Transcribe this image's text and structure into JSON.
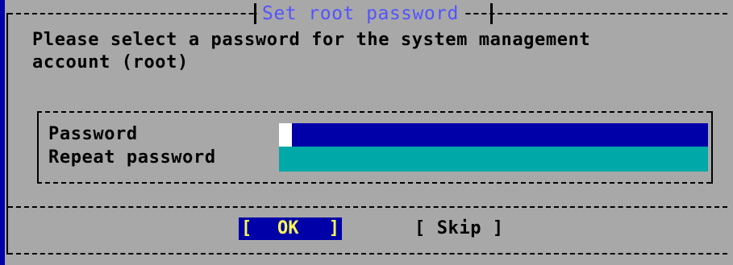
{
  "dialog": {
    "title": "Set root password",
    "prompt": "Please select a password for the system management\naccount (root)"
  },
  "form": {
    "password_label": "Password",
    "repeat_label": "Repeat password",
    "password_value": "",
    "repeat_value": ""
  },
  "buttons": {
    "ok_open": "[",
    "ok_label": "OK",
    "ok_close": "]",
    "skip_label": "[ Skip ]"
  },
  "colors": {
    "background": "#0000a8",
    "dialog": "#a8a8a8",
    "title": "#5454fc",
    "active_field": "#0000a8",
    "inactive_field": "#00a8a8",
    "selected_button_text": "#fcfc54"
  }
}
